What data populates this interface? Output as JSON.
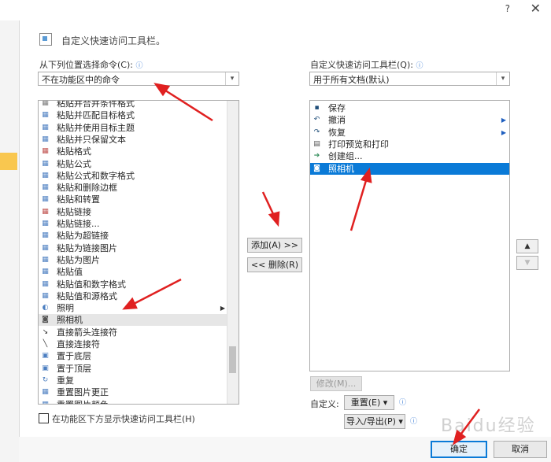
{
  "titlebar": {
    "help": "?",
    "close": "✕"
  },
  "heading": "自定义快速访问工具栏。",
  "left": {
    "choose_label": "从下列位置选择命令(C):",
    "choose_value": "不在功能区中的命令",
    "items": [
      {
        "label": "粘贴并合并条件格式",
        "icon": "▦",
        "color": "#7a7a7a"
      },
      {
        "label": "粘贴并匹配目标格式",
        "icon": "▦",
        "color": "#4c7fc1"
      },
      {
        "label": "粘贴并使用目标主题",
        "icon": "▦",
        "color": "#4c7fc1"
      },
      {
        "label": "粘贴并只保留文本",
        "icon": "▦",
        "color": "#4c7fc1"
      },
      {
        "label": "粘贴格式",
        "icon": "▦",
        "color": "#c0504d"
      },
      {
        "label": "粘贴公式",
        "icon": "▦",
        "color": "#4c7fc1"
      },
      {
        "label": "粘贴公式和数字格式",
        "icon": "▦",
        "color": "#4c7fc1"
      },
      {
        "label": "粘贴和删除边框",
        "icon": "▦",
        "color": "#4c7fc1"
      },
      {
        "label": "粘贴和转置",
        "icon": "▦",
        "color": "#4c7fc1"
      },
      {
        "label": "粘贴链接",
        "icon": "▦",
        "color": "#c0504d"
      },
      {
        "label": "粘贴链接...",
        "icon": "▦",
        "color": "#4c7fc1"
      },
      {
        "label": "粘贴为超链接",
        "icon": "▦",
        "color": "#4c7fc1"
      },
      {
        "label": "粘贴为链接图片",
        "icon": "▦",
        "color": "#4c7fc1"
      },
      {
        "label": "粘贴为图片",
        "icon": "▦",
        "color": "#4c7fc1"
      },
      {
        "label": "粘贴值",
        "icon": "▦",
        "color": "#4c7fc1"
      },
      {
        "label": "粘贴值和数字格式",
        "icon": "▦",
        "color": "#4c7fc1"
      },
      {
        "label": "粘贴值和源格式",
        "icon": "▦",
        "color": "#4c7fc1"
      },
      {
        "label": "照明",
        "icon": "◐",
        "color": "#4c7fc1"
      },
      {
        "label": "照相机",
        "icon": "◙",
        "color": "#555555"
      },
      {
        "label": "直接箭头连接符",
        "icon": "↘",
        "color": "#333333"
      },
      {
        "label": "直接连接符",
        "icon": "╲",
        "color": "#333333"
      },
      {
        "label": "置于底层",
        "icon": "▣",
        "color": "#4c7fc1"
      },
      {
        "label": "置于顶层",
        "icon": "▣",
        "color": "#4c7fc1"
      },
      {
        "label": "重复",
        "icon": "↻",
        "color": "#4c7fc1"
      },
      {
        "label": "重置图片更正",
        "icon": "▦",
        "color": "#4c7fc1"
      },
      {
        "label": "重置图片颜色",
        "icon": "▦",
        "color": "#4c7fc1"
      }
    ],
    "show_below_label": "在功能区下方显示快速访问工具栏(H)"
  },
  "middle": {
    "add": "添加(A) >>",
    "remove": "<< 删除(R)"
  },
  "right": {
    "qat_label": "自定义快速访问工具栏(Q):",
    "qat_value": "用于所有文档(默认)",
    "items": [
      {
        "label": "保存",
        "icon": "▪",
        "color": "#1f4e79"
      },
      {
        "label": "撤消",
        "icon": "↶",
        "color": "#1f4e79"
      },
      {
        "label": "恢复",
        "icon": "↷",
        "color": "#1f4e79"
      },
      {
        "label": "打印预览和打印",
        "icon": "▤",
        "color": "#555555"
      },
      {
        "label": "创建组...",
        "icon": "➔",
        "color": "#2e8b57"
      },
      {
        "label": "照相机",
        "icon": "◙",
        "color": "#ffffff"
      }
    ],
    "modify": "修改(M)...",
    "customize_label": "自定义:",
    "reset": "重置(E) ▾",
    "import_export": "导入/导出(P) ▾"
  },
  "footer": {
    "ok": "确定",
    "cancel": "取消"
  },
  "watermark": "Baidu经验"
}
